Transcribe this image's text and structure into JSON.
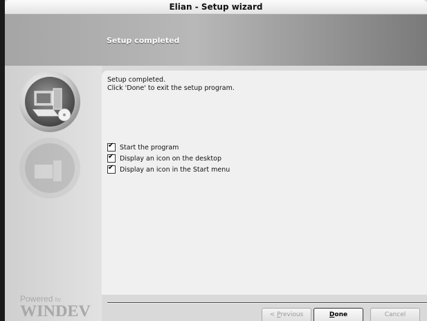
{
  "window": {
    "title": "Elian - Setup wizard"
  },
  "header": {
    "title": "Setup completed"
  },
  "content": {
    "line1": "Setup completed.",
    "line2": "Click 'Done' to exit the setup program."
  },
  "options": [
    {
      "label": "Start the program",
      "checked": true
    },
    {
      "label": "Display an icon on the desktop",
      "checked": true
    },
    {
      "label": "Display an icon in the Start menu",
      "checked": true
    }
  ],
  "branding": {
    "powered": "Powered",
    "by": "by",
    "product": "WINDEV"
  },
  "buttons": {
    "previous": {
      "prefix": "< ",
      "mnemonic": "P",
      "rest": "revious",
      "enabled": false
    },
    "done": {
      "mnemonic": "D",
      "rest": "one",
      "enabled": true
    },
    "cancel": {
      "label": "Cancel",
      "enabled": false
    }
  }
}
